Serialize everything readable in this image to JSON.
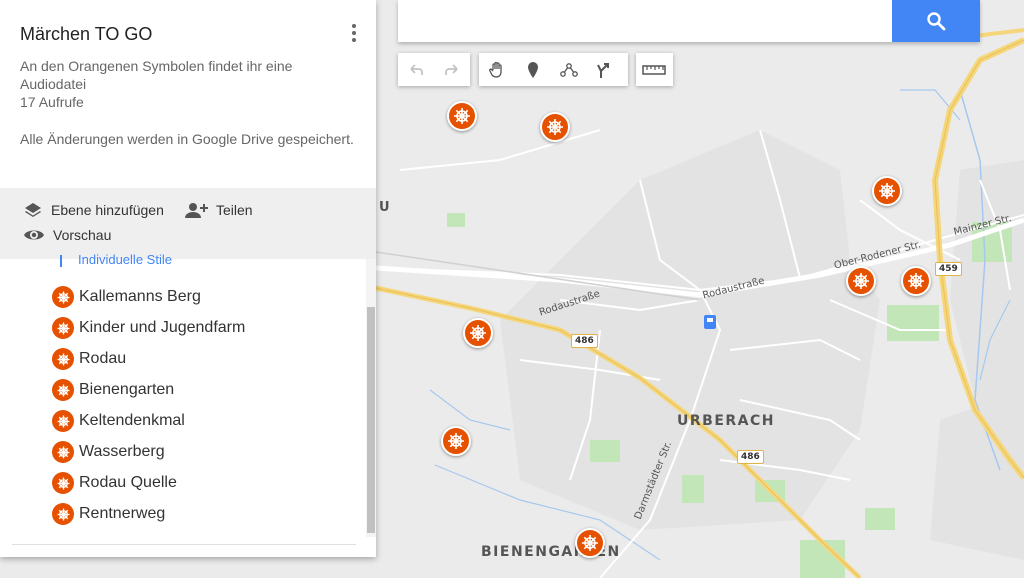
{
  "panel": {
    "title": "Märchen TO GO",
    "description": "An den Orangenen Symbolen findet ihr eine Audiodatei",
    "views": "17 Aufrufe",
    "saved_note": "Alle Änderungen werden in Google Drive gespeichert.",
    "add_layer_label": "Ebene hinzufügen",
    "share_label": "Teilen",
    "preview_label": "Vorschau",
    "styles_link": "Individuelle Stile",
    "places": [
      "Kallemanns Berg",
      "Kinder und Jugendfarm",
      "Rodau",
      "Bienengarten",
      "Keltendenkmal",
      "Wasserberg",
      "Rodau Quelle",
      "Rentnerweg"
    ]
  },
  "search": {
    "value": "",
    "placeholder": ""
  },
  "toolbar": {
    "icons": [
      "undo-icon",
      "redo-icon",
      "hand-icon",
      "marker-icon",
      "line-icon",
      "directions-icon",
      "ruler-icon"
    ]
  },
  "map": {
    "labels": {
      "rodaustrasse_west": "Rodaustraße",
      "rodaustrasse_east": "Rodaustraße",
      "ober_rodener": "Ober-Rodener Str.",
      "mainzer": "Mainzer Str.",
      "darmstaedter": "Darmstädter Str.",
      "partial_u": "U"
    },
    "cities": {
      "urberach": "URBERACH",
      "bienengarten": "BIENENGARTEN"
    },
    "shields": {
      "r486_west": "486",
      "r486_south": "486",
      "r459": "459"
    },
    "colors": {
      "marker": "#e65100",
      "search_button": "#4285f4",
      "highway": "#f5d67a",
      "water": "#a6c8ef",
      "park": "#c3e6b9"
    }
  }
}
